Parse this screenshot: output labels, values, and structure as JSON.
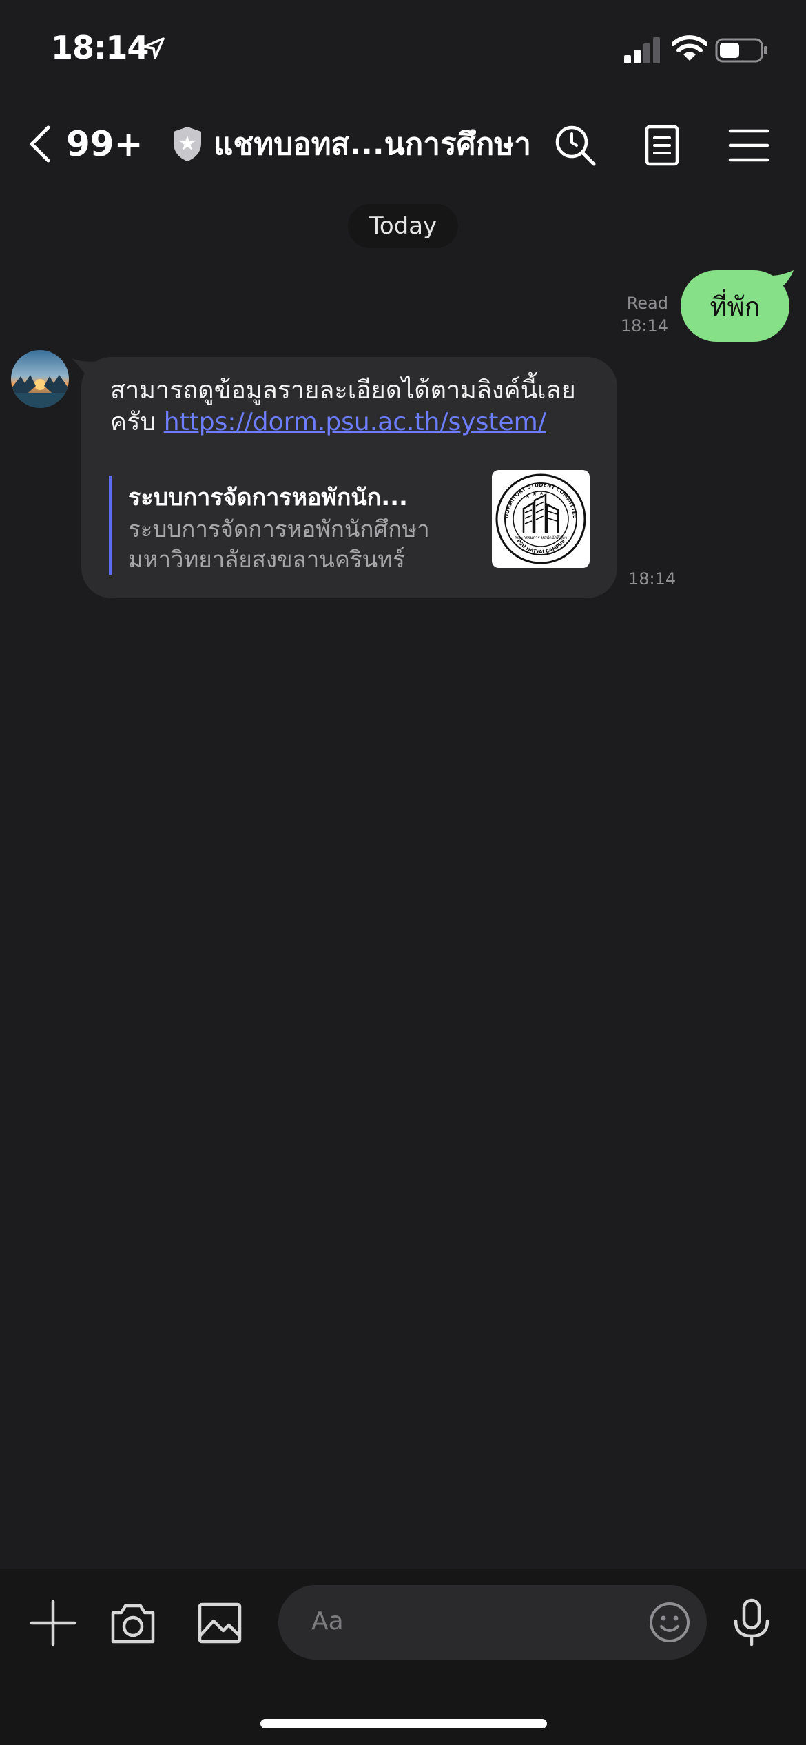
{
  "status_bar": {
    "time": "18:14",
    "battery_level": 0.5
  },
  "header": {
    "back_count": "99+",
    "title": "แชทบอทส...นการศึกษา"
  },
  "chat": {
    "date_label": "Today",
    "outgoing": {
      "text": "ที่พัก",
      "read_label": "Read",
      "time": "18:14"
    },
    "incoming": {
      "text": "สามารถดูข้อมูลรายละเอียดได้ตามลิงค์นี้เลยครับ ",
      "link": "https://dorm.psu.ac.th/system/",
      "time": "18:14",
      "preview": {
        "title": "ระบบการจัดการหอพักนัก...",
        "description": "ระบบการจัดการหอพักนักศึกษามหาวิทยาลัยสงขลานครินทร์",
        "logo_top_text": "DORMITORY STUDENT COMMITTEE",
        "logo_bottom_text": "PSU HATYAI CAMPUS",
        "logo_center_text": "คณะกรรมการ หอพักนักศึกษา"
      }
    }
  },
  "input_bar": {
    "placeholder": "Aa"
  },
  "colors": {
    "background": "#1c1c1e",
    "outgoing_bubble": "#86e087",
    "incoming_bubble": "#2c2c2e",
    "link": "#6c7dff"
  },
  "icons": [
    "location-arrow-icon",
    "signal-icon",
    "wifi-icon",
    "battery-icon",
    "back-chevron-icon",
    "shield-icon",
    "search-icon",
    "notes-icon",
    "menu-icon",
    "plus-icon",
    "camera-icon",
    "image-icon",
    "emoji-icon",
    "mic-icon"
  ]
}
